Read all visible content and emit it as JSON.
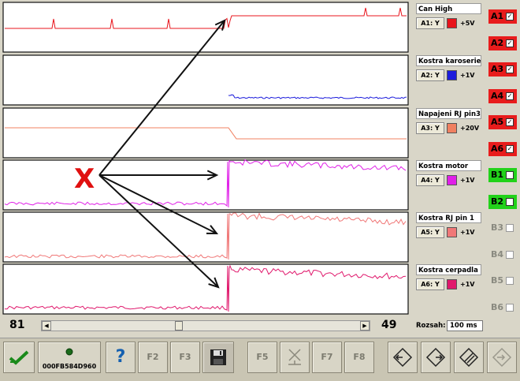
{
  "channels": [
    {
      "title": "Can High",
      "button": "A1: Y",
      "color": "#e8141c",
      "scale": "+5V"
    },
    {
      "title": "Kostra karoserie",
      "button": "A2: Y",
      "color": "#1c1cdc",
      "scale": "+1V"
    },
    {
      "title": "Napajeni RJ pin3",
      "button": "A3: Y",
      "color": "#f08060",
      "scale": "+20V"
    },
    {
      "title": "Kostra motor",
      "button": "A4: Y",
      "color": "#e020e8",
      "scale": "+1V"
    },
    {
      "title": "Kostra RJ pin 1",
      "button": "A5: Y",
      "color": "#f07878",
      "scale": "+1V"
    },
    {
      "title": "Kostra cerpadla",
      "button": "A6: Y",
      "color": "#e0186c",
      "scale": "+1V"
    }
  ],
  "selectors": [
    {
      "label": "A1",
      "checked": true,
      "style": "red"
    },
    {
      "label": "A2",
      "checked": true,
      "style": "red"
    },
    {
      "label": "A3",
      "checked": true,
      "style": "red"
    },
    {
      "label": "A4",
      "checked": true,
      "style": "red"
    },
    {
      "label": "A5",
      "checked": true,
      "style": "red"
    },
    {
      "label": "A6",
      "checked": true,
      "style": "red"
    },
    {
      "label": "B1",
      "checked": false,
      "style": "green"
    },
    {
      "label": "B2",
      "checked": false,
      "style": "green"
    },
    {
      "label": "B3",
      "checked": false,
      "style": "off"
    },
    {
      "label": "B4",
      "checked": false,
      "style": "off"
    },
    {
      "label": "B5",
      "checked": false,
      "style": "off"
    },
    {
      "label": "B6",
      "checked": false,
      "style": "off"
    }
  ],
  "annotation": {
    "marker": "X",
    "color": "#e01010"
  },
  "scrollbar": {
    "left_value": "81",
    "right_value": "49",
    "position": 0.41
  },
  "range": {
    "label": "Rozsah:",
    "value": "100 ms"
  },
  "toolbar": {
    "device_id": "000FB584D960",
    "help": "?",
    "f2": "F2",
    "f3": "F3",
    "f5": "F5",
    "f7": "F7",
    "f8": "F8"
  }
}
